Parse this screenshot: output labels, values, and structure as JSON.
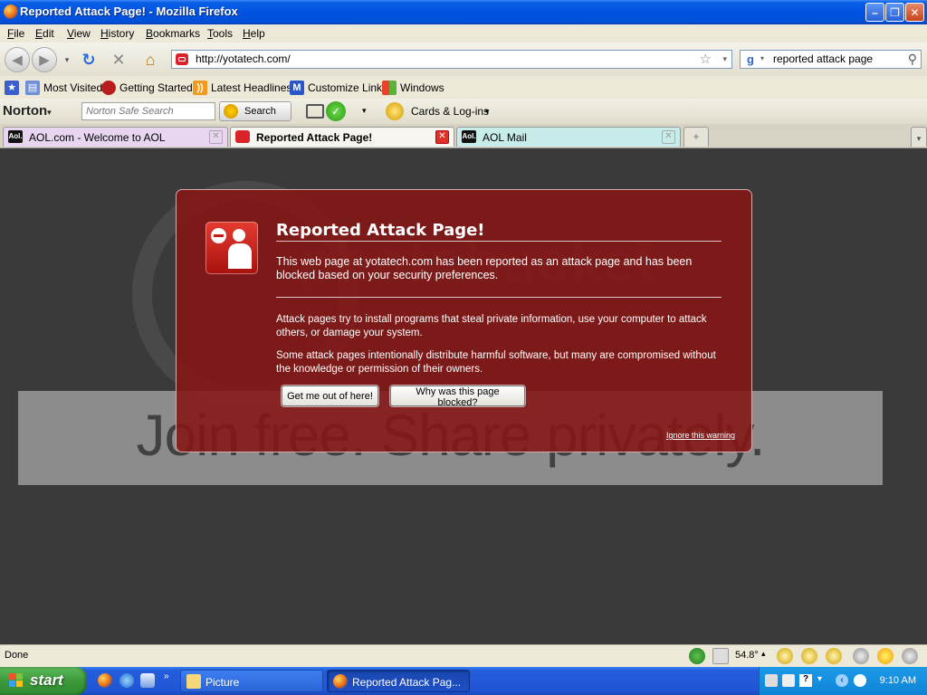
{
  "window": {
    "title": "Reported Attack Page! - Mozilla Firefox"
  },
  "menu": [
    "File",
    "Edit",
    "View",
    "History",
    "Bookmarks",
    "Tools",
    "Help"
  ],
  "nav": {
    "url": "http://yotatech.com/",
    "search_value": "reported attack page"
  },
  "bookmarks": [
    "Most Visited",
    "Getting Started",
    "Latest Headlines",
    "Customize Links",
    "Windows"
  ],
  "norton": {
    "logo": "Norton",
    "search_placeholder": "Norton Safe Search",
    "search_button": "Search",
    "cards_label": "Cards & Log-ins"
  },
  "tabs": [
    {
      "label": "AOL.com - Welcome to AOL",
      "fav": "Aol."
    },
    {
      "label": "Reported Attack Page!",
      "fav": ""
    },
    {
      "label": "AOL Mail",
      "fav": "Aol."
    }
  ],
  "watermark": {
    "brand": "photobucket",
    "tagline": "Join free. Share privately."
  },
  "error": {
    "title": "Reported Attack Page!",
    "short_desc": "This web page at yotatech.com has been reported as an attack page and has been blocked based on your security preferences.",
    "long_desc_1": "Attack pages try to install programs that steal private information, use your computer to attack others, or damage your system.",
    "long_desc_2": "Some attack pages intentionally distribute harmful software, but many are compromised without the knowledge or permission of their owners.",
    "get_me_out": "Get me out of here!",
    "why_blocked": "Why was this page blocked?",
    "ignore": "Ignore this warning"
  },
  "status": {
    "text": "Done",
    "temperature": "54.8°"
  },
  "taskbar": {
    "start": "start",
    "tasks": [
      "Picture",
      "Reported Attack Pag..."
    ],
    "clock": "9:10 AM"
  },
  "colors": {
    "error_bg": "#851414",
    "xp_blue": "#245edb",
    "start_green": "#3c9a3c"
  }
}
